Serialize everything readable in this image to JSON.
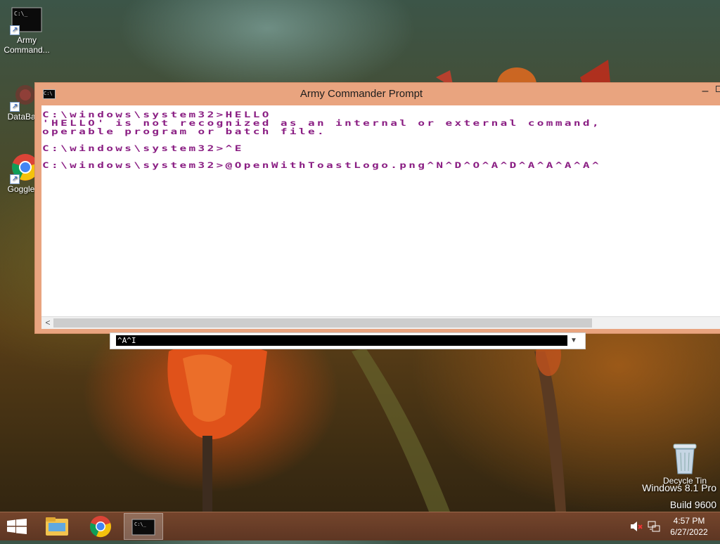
{
  "desktop": {
    "icons": [
      {
        "label": "Army\nCommand..."
      },
      {
        "label": "DataBarg"
      },
      {
        "label": "Goggle D"
      },
      {
        "label": "Decycle Tin"
      }
    ],
    "watermark": {
      "line1": "Windows 8.1 Pro",
      "line2": "Build 9600"
    }
  },
  "window": {
    "title": "Army Commander Prompt",
    "minimize_glyph": "–",
    "console_lines": [
      "C:\\windows\\system32>HELLO",
      "'HELLO' is not recognized as an internal or external command,",
      "operable program or batch file.",
      "C:\\windows\\system32>^E",
      "C:\\windows\\system32>@OpenWithToastLogo.png^N^D^O^A^D^A^A^A^A^"
    ],
    "text_color": "#8a1e83",
    "scroll_left_glyph": "<"
  },
  "input_strip": {
    "value": "^A^I"
  },
  "taskbar": {
    "clock_time": "4:57 PM",
    "clock_date": "6/27/2022",
    "accent_color": "#6a3f28"
  }
}
